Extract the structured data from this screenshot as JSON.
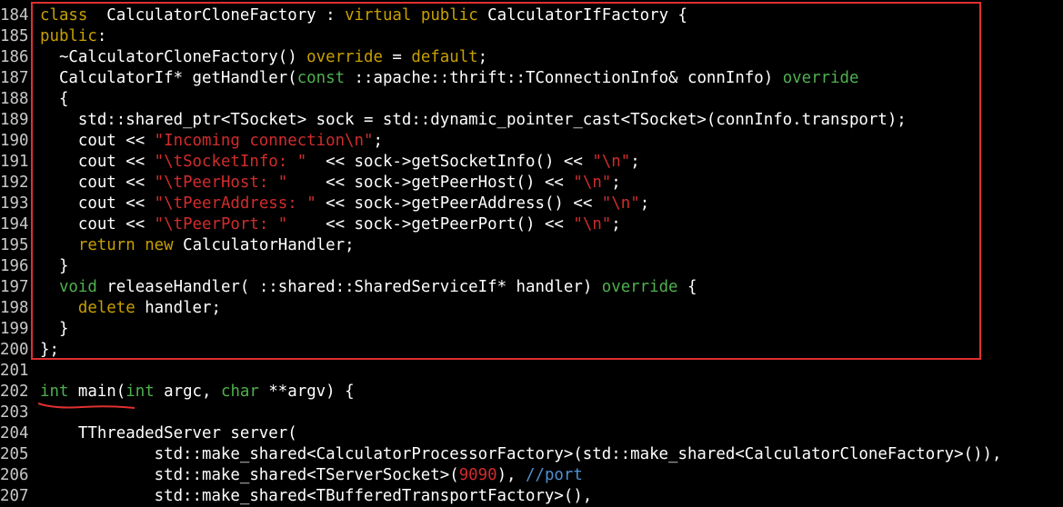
{
  "editor": {
    "lines": [
      {
        "n": "184",
        "t": [
          [
            "kw",
            "class"
          ],
          [
            "",
            "  CalculatorCloneFactory : "
          ],
          [
            "kw",
            "virtual"
          ],
          [
            "",
            " "
          ],
          [
            "kw",
            "public"
          ],
          [
            "",
            " CalculatorIfFactory {"
          ]
        ]
      },
      {
        "n": "185",
        "t": [
          [
            "",
            ""
          ],
          [
            "kw",
            "public"
          ],
          [
            "",
            ":"
          ]
        ]
      },
      {
        "n": "186",
        "t": [
          [
            "",
            "  ~CalculatorCloneFactory() "
          ],
          [
            "kw",
            "override"
          ],
          [
            "",
            " = "
          ],
          [
            "kw",
            "default"
          ],
          [
            "",
            ";"
          ]
        ]
      },
      {
        "n": "187",
        "t": [
          [
            "",
            "  CalculatorIf* getHandler("
          ],
          [
            "ty",
            "const"
          ],
          [
            "",
            " ::apache::thrift::TConnectionInfo& connInfo) "
          ],
          [
            "ty",
            "override"
          ]
        ]
      },
      {
        "n": "188",
        "t": [
          [
            "",
            "  {"
          ]
        ]
      },
      {
        "n": "189",
        "t": [
          [
            "",
            "    std::shared_ptr<TSocket> sock = std::dynamic_pointer_cast<TSocket>(connInfo.transport);"
          ]
        ]
      },
      {
        "n": "190",
        "t": [
          [
            "",
            "    cout << "
          ],
          [
            "str",
            "\"Incoming connection"
          ],
          [
            "esc",
            "\\n"
          ],
          [
            "str",
            "\""
          ],
          [
            "",
            ";"
          ]
        ]
      },
      {
        "n": "191",
        "t": [
          [
            "",
            "    cout << "
          ],
          [
            "str",
            "\""
          ],
          [
            "esc",
            "\\t"
          ],
          [
            "str",
            "SocketInfo: \""
          ],
          [
            "",
            "  << sock->getSocketInfo() << "
          ],
          [
            "str",
            "\""
          ],
          [
            "esc",
            "\\n"
          ],
          [
            "str",
            "\""
          ],
          [
            "",
            ";"
          ]
        ]
      },
      {
        "n": "192",
        "t": [
          [
            "",
            "    cout << "
          ],
          [
            "str",
            "\""
          ],
          [
            "esc",
            "\\t"
          ],
          [
            "str",
            "PeerHost: \""
          ],
          [
            "",
            "    << sock->getPeerHost() << "
          ],
          [
            "str",
            "\""
          ],
          [
            "esc",
            "\\n"
          ],
          [
            "str",
            "\""
          ],
          [
            "",
            ";"
          ]
        ]
      },
      {
        "n": "193",
        "t": [
          [
            "",
            "    cout << "
          ],
          [
            "str",
            "\""
          ],
          [
            "esc",
            "\\t"
          ],
          [
            "str",
            "PeerAddress: \""
          ],
          [
            "",
            " << sock->getPeerAddress() << "
          ],
          [
            "str",
            "\""
          ],
          [
            "esc",
            "\\n"
          ],
          [
            "str",
            "\""
          ],
          [
            "",
            ";"
          ]
        ]
      },
      {
        "n": "194",
        "t": [
          [
            "",
            "    cout << "
          ],
          [
            "str",
            "\""
          ],
          [
            "esc",
            "\\t"
          ],
          [
            "str",
            "PeerPort: \""
          ],
          [
            "",
            "    << sock->getPeerPort() << "
          ],
          [
            "str",
            "\""
          ],
          [
            "esc",
            "\\n"
          ],
          [
            "str",
            "\""
          ],
          [
            "",
            ";"
          ]
        ]
      },
      {
        "n": "195",
        "t": [
          [
            "",
            "    "
          ],
          [
            "kw",
            "return"
          ],
          [
            "",
            " "
          ],
          [
            "kw",
            "new"
          ],
          [
            "",
            " CalculatorHandler;"
          ]
        ]
      },
      {
        "n": "196",
        "t": [
          [
            "",
            "  }"
          ]
        ]
      },
      {
        "n": "197",
        "t": [
          [
            "",
            "  "
          ],
          [
            "ty",
            "void"
          ],
          [
            "",
            " releaseHandler( ::shared::SharedServiceIf* handler) "
          ],
          [
            "ty",
            "override"
          ],
          [
            "",
            " {"
          ]
        ]
      },
      {
        "n": "198",
        "t": [
          [
            "",
            "    "
          ],
          [
            "kw",
            "delete"
          ],
          [
            "",
            " handler;"
          ]
        ]
      },
      {
        "n": "199",
        "t": [
          [
            "",
            "  }"
          ]
        ]
      },
      {
        "n": "200",
        "t": [
          [
            "",
            "};"
          ]
        ]
      },
      {
        "n": "201",
        "t": [
          [
            "",
            ""
          ]
        ]
      },
      {
        "n": "202",
        "t": [
          [
            "ty",
            "int"
          ],
          [
            "",
            " main("
          ],
          [
            "ty",
            "int"
          ],
          [
            "",
            " argc, "
          ],
          [
            "ty",
            "char"
          ],
          [
            "",
            " **argv) {"
          ]
        ]
      },
      {
        "n": "203",
        "t": [
          [
            "",
            ""
          ]
        ]
      },
      {
        "n": "204",
        "t": [
          [
            "",
            "    TThreadedServer server("
          ]
        ]
      },
      {
        "n": "205",
        "t": [
          [
            "",
            "            std::make_shared<CalculatorProcessorFactory>(std::make_shared<CalculatorCloneFactory>()),"
          ]
        ]
      },
      {
        "n": "206",
        "t": [
          [
            "",
            "            std::make_shared<TServerSocket>("
          ],
          [
            "num",
            "9090"
          ],
          [
            "",
            "), "
          ],
          [
            "cm",
            "//port"
          ]
        ]
      },
      {
        "n": "207",
        "t": [
          [
            "",
            "            std::make_shared<TBufferedTransportFactory>(),"
          ]
        ]
      }
    ]
  },
  "colors": {
    "background": "#000000",
    "line_number": "#c8c8c8",
    "keyword": "#c8a000",
    "type": "#4fb04f",
    "string": "#d12c2c",
    "comment": "#5090d0",
    "annotation": "#e03030"
  }
}
